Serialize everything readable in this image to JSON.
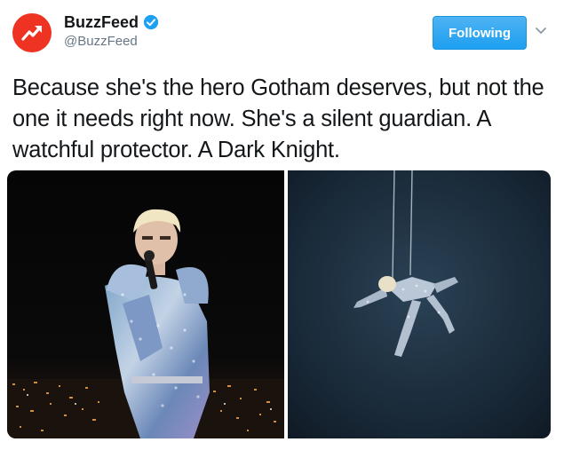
{
  "account": {
    "display_name": "BuzzFeed",
    "handle": "@BuzzFeed",
    "verified": true,
    "avatar_icon": "buzzfeed-trending-arrow-icon",
    "avatar_color": "#ee3322"
  },
  "follow_button": {
    "label": "Following",
    "color": "#1da1f2"
  },
  "tweet": {
    "text": "Because she's the hero Gotham deserves, but not the one it needs right now. She's a silent guardian. A watchful protector. A Dark Knight."
  },
  "media": [
    {
      "icon": "photo-performer-microphone"
    },
    {
      "icon": "photo-performer-suspended-wires"
    }
  ]
}
